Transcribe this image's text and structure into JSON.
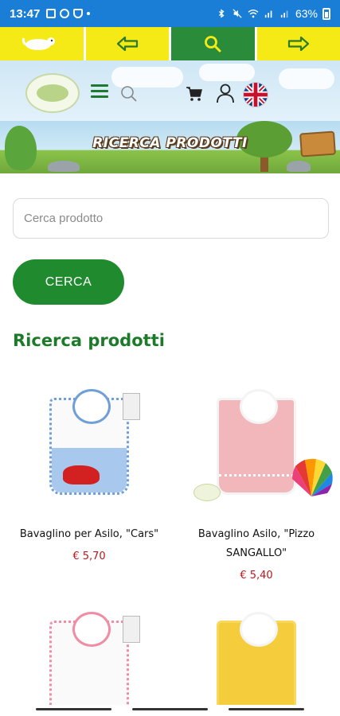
{
  "status_bar": {
    "time": "13:47",
    "battery": "63%"
  },
  "top_nav": {
    "items": [
      {
        "icon": "logo-mascot-icon"
      },
      {
        "icon": "arrow-left-icon"
      },
      {
        "icon": "search-icon"
      },
      {
        "icon": "arrow-right-icon"
      }
    ],
    "active_index": 2,
    "accent": "#f6ea16",
    "active_color": "#2a8c3a"
  },
  "header": {
    "icons": [
      "menu-icon",
      "search-icon",
      "cart-icon",
      "user-icon",
      "uk-flag-icon"
    ]
  },
  "banner": {
    "title": "RICERCA PRODOTTI"
  },
  "search": {
    "placeholder": "Cerca prodotto",
    "value": "",
    "button_label": "CERCA"
  },
  "section": {
    "title": "Ricerca prodotti"
  },
  "products": [
    {
      "name_line1": "Bavaglino per Asilo, \"Cars\"",
      "name_line2": "",
      "price": "€ 5,70"
    },
    {
      "name_line1": "Bavaglino Asilo, \"Pizzo",
      "name_line2": "SANGALLO\"",
      "price": "€ 5,40"
    },
    {
      "name_line1": "",
      "name_line2": "",
      "price": ""
    },
    {
      "name_line1": "",
      "name_line2": "",
      "price": ""
    }
  ],
  "colors": {
    "brand_green": "#1f8a2e",
    "price_red": "#c0131a",
    "status_blue": "#1a7ed6"
  }
}
